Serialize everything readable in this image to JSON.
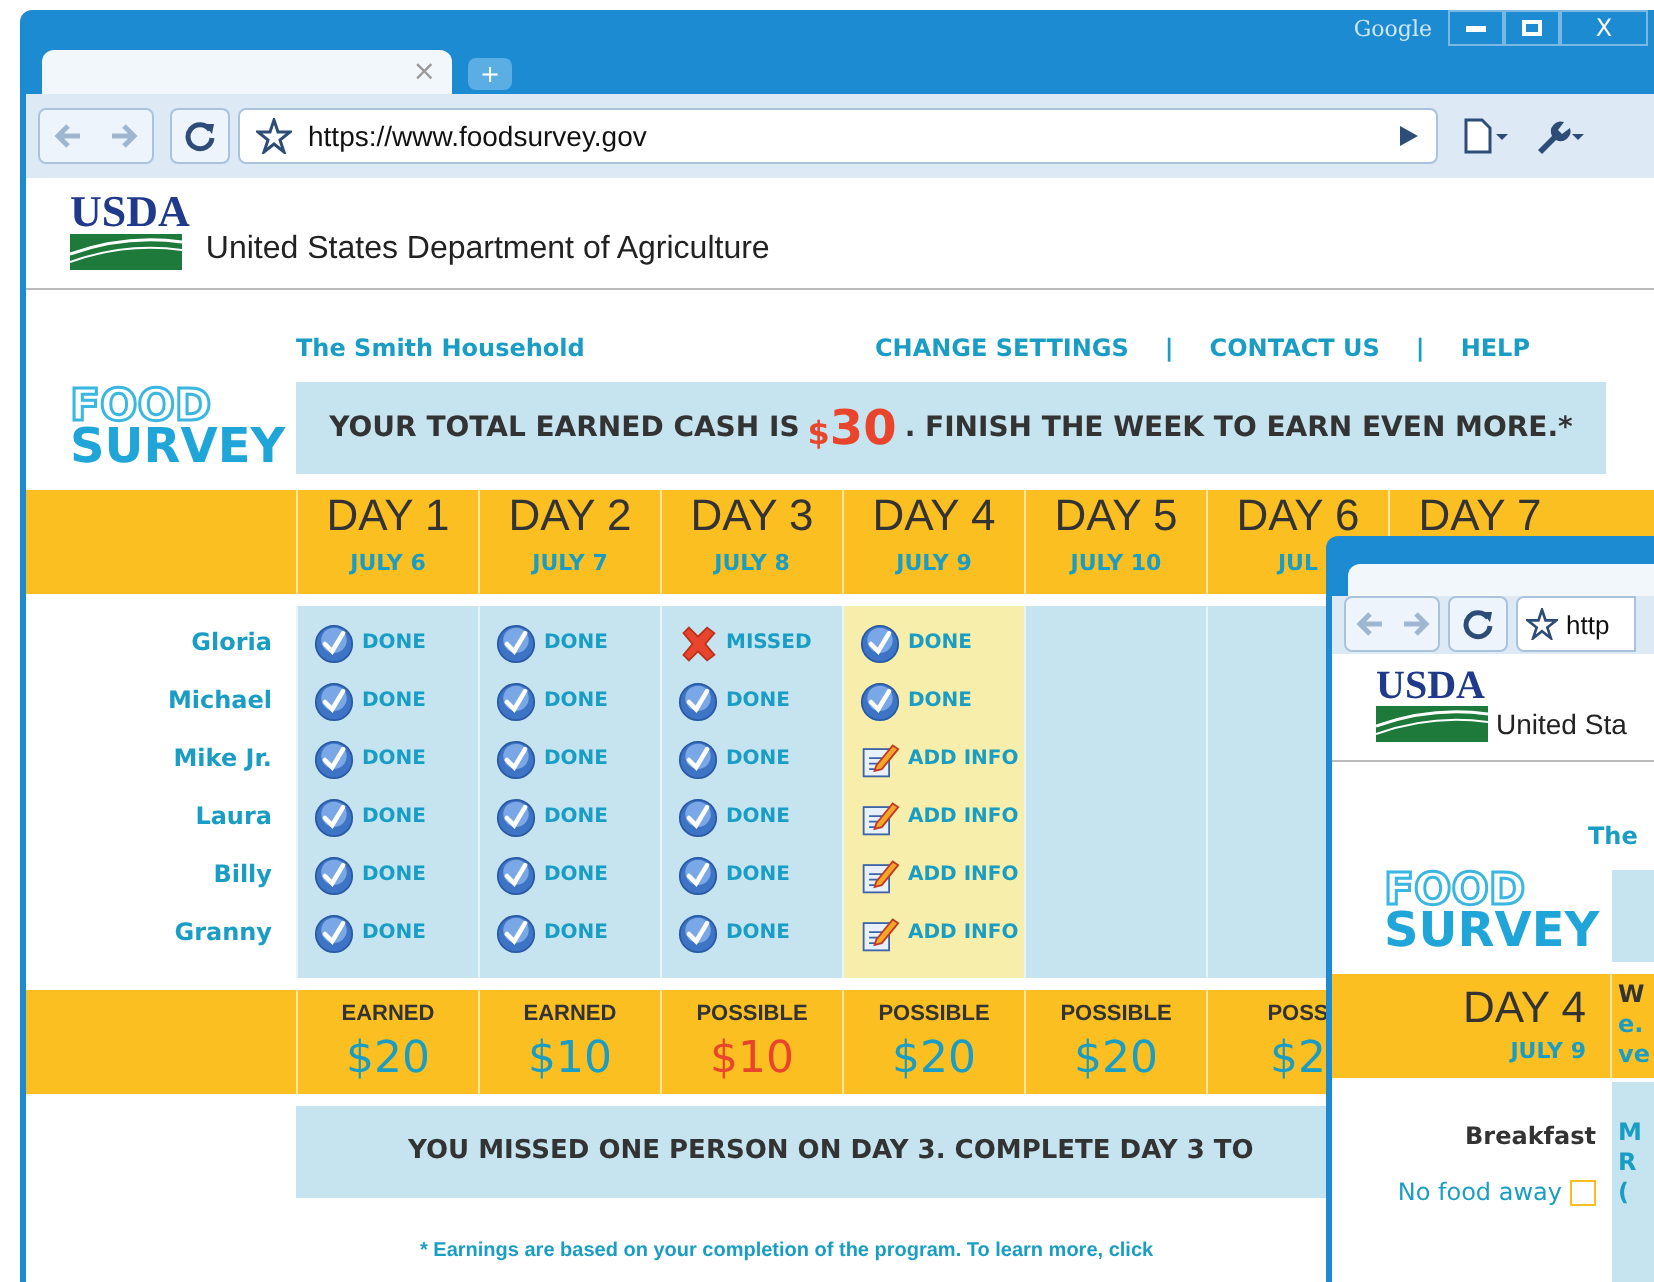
{
  "browser": {
    "brand": "Google",
    "close_label": "X",
    "tab_close": "×",
    "new_tab": "+",
    "address": "https://www.foodsurvey.gov"
  },
  "header": {
    "agency_short": "USDA",
    "agency_name": "United States Department of Agriculture"
  },
  "household": "The Smith Household",
  "nav_links": [
    "CHANGE SETTINGS",
    "|",
    "CONTACT US",
    "|",
    "HELP"
  ],
  "logo": {
    "top": "FOOD",
    "bottom": "SURVEY"
  },
  "banner": {
    "prefix": "YOUR TOTAL EARNED CASH IS",
    "currency": "$",
    "amount": "30",
    "suffix": ". FINISH THE WEEK TO EARN EVEN MORE.*"
  },
  "days": [
    {
      "day": "DAY 1",
      "date": "JULY 6",
      "selected": false
    },
    {
      "day": "DAY 2",
      "date": "JULY 7",
      "selected": false
    },
    {
      "day": "DAY 3",
      "date": "JULY 8",
      "selected": false
    },
    {
      "day": "DAY 4",
      "date": "JULY 9",
      "selected": true
    },
    {
      "day": "DAY 5",
      "date": "JULY 10",
      "selected": false
    },
    {
      "day": "DAY 6",
      "date": "JUL",
      "selected": false
    },
    {
      "day": "DAY 7"
    }
  ],
  "people": [
    {
      "name": "Gloria",
      "statuses": [
        {
          "kind": "done",
          "label": "DONE"
        },
        {
          "kind": "done",
          "label": "DONE"
        },
        {
          "kind": "missed",
          "label": "MISSED"
        },
        {
          "kind": "done",
          "label": "DONE"
        }
      ]
    },
    {
      "name": "Michael",
      "statuses": [
        {
          "kind": "done",
          "label": "DONE"
        },
        {
          "kind": "done",
          "label": "DONE"
        },
        {
          "kind": "done",
          "label": "DONE"
        },
        {
          "kind": "done",
          "label": "DONE"
        }
      ]
    },
    {
      "name": "Mike Jr.",
      "statuses": [
        {
          "kind": "done",
          "label": "DONE"
        },
        {
          "kind": "done",
          "label": "DONE"
        },
        {
          "kind": "done",
          "label": "DONE"
        },
        {
          "kind": "add",
          "label": "ADD INFO"
        }
      ]
    },
    {
      "name": "Laura",
      "statuses": [
        {
          "kind": "done",
          "label": "DONE"
        },
        {
          "kind": "done",
          "label": "DONE"
        },
        {
          "kind": "done",
          "label": "DONE"
        },
        {
          "kind": "add",
          "label": "ADD INFO"
        }
      ]
    },
    {
      "name": "Billy",
      "statuses": [
        {
          "kind": "done",
          "label": "DONE"
        },
        {
          "kind": "done",
          "label": "DONE"
        },
        {
          "kind": "done",
          "label": "DONE"
        },
        {
          "kind": "add",
          "label": "ADD INFO"
        }
      ]
    },
    {
      "name": "Granny",
      "statuses": [
        {
          "kind": "done",
          "label": "DONE"
        },
        {
          "kind": "done",
          "label": "DONE"
        },
        {
          "kind": "done",
          "label": "DONE"
        },
        {
          "kind": "add",
          "label": "ADD INFO"
        }
      ]
    }
  ],
  "earnings": [
    {
      "label": "EARNED",
      "amount": "$20",
      "missed": false
    },
    {
      "label": "EARNED",
      "amount": "$10",
      "missed": false
    },
    {
      "label": "POSSIBLE",
      "amount": "$10",
      "missed": true
    },
    {
      "label": "POSSIBLE",
      "amount": "$20",
      "missed": false
    },
    {
      "label": "POSSIBLE",
      "amount": "$20",
      "missed": false
    },
    {
      "label": "POSS",
      "amount": "$2",
      "missed": false
    }
  ],
  "notice": "YOU MISSED ONE PERSON ON DAY 3. COMPLETE DAY 3 TO",
  "footnote": "* Earnings are based on your completion of the program. To learn more, click",
  "second_window": {
    "address": "http",
    "agency_short": "USDA",
    "agency_name": "United Sta",
    "household": "The",
    "logo": {
      "top": "FOOD",
      "bottom": "SURVEY"
    },
    "day": "DAY 4",
    "date": "JULY 9",
    "question_lines": [
      "W",
      "e.",
      "ve"
    ],
    "meal": "Breakfast",
    "meal_lines": [
      "M",
      "R",
      "("
    ],
    "no_food": {
      "label": "No food away",
      "checked": false
    }
  }
}
